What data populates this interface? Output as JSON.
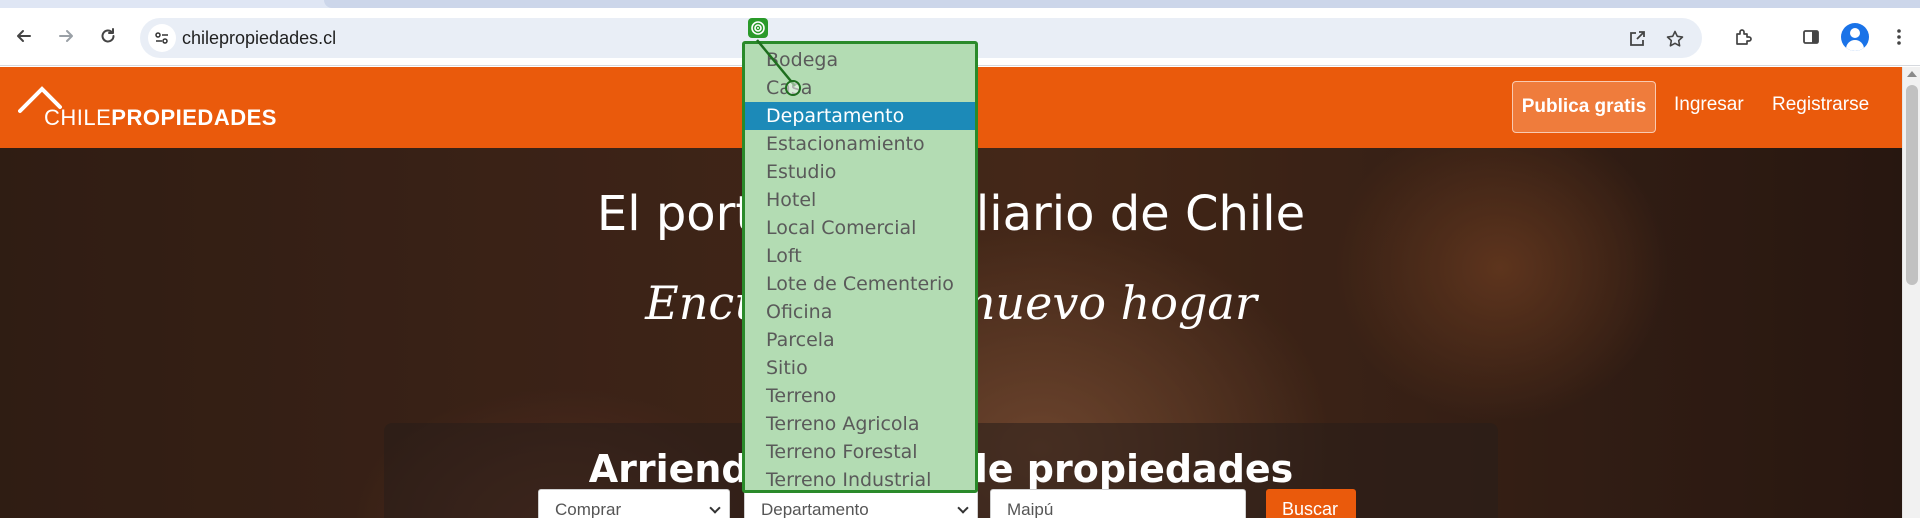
{
  "browser": {
    "url": "chilepropiedades.cl",
    "icons": [
      "back-arrow-icon",
      "forward-arrow-icon",
      "reload-icon",
      "site-info-icon",
      "share-icon",
      "bookmark-star-icon",
      "extensions-icon",
      "side-panel-icon",
      "profile-icon",
      "menu-dots-icon"
    ]
  },
  "header": {
    "logo_part1": "CHILE",
    "logo_part2": "PROPIEDADES",
    "publish_label": "Publica gratis",
    "login_label": "Ingresar",
    "register_label": "Registrarse"
  },
  "hero": {
    "title": "El portal inmobiliario de Chile",
    "subtitle": "Encuentra tu nuevo hogar",
    "search_title": "Arriendo y venta de propiedades",
    "operation_value": "Comprar",
    "type_value": "Departamento",
    "location_value": "Maipú",
    "search_button": "Buscar"
  },
  "dropdown": {
    "selected": "Departamento",
    "options": [
      "Bodega",
      "Casa",
      "Departamento",
      "Estacionamiento",
      "Estudio",
      "Hotel",
      "Local Comercial",
      "Loft",
      "Lote de Cementerio",
      "Oficina",
      "Parcela",
      "Sitio",
      "Terreno",
      "Terreno Agricola",
      "Terreno Forestal",
      "Terreno Industrial"
    ]
  },
  "colors": {
    "brand_orange": "#ea5a0c",
    "dropdown_highlight": "#1c8ab8",
    "overlay_green": "#b3dcb3"
  }
}
